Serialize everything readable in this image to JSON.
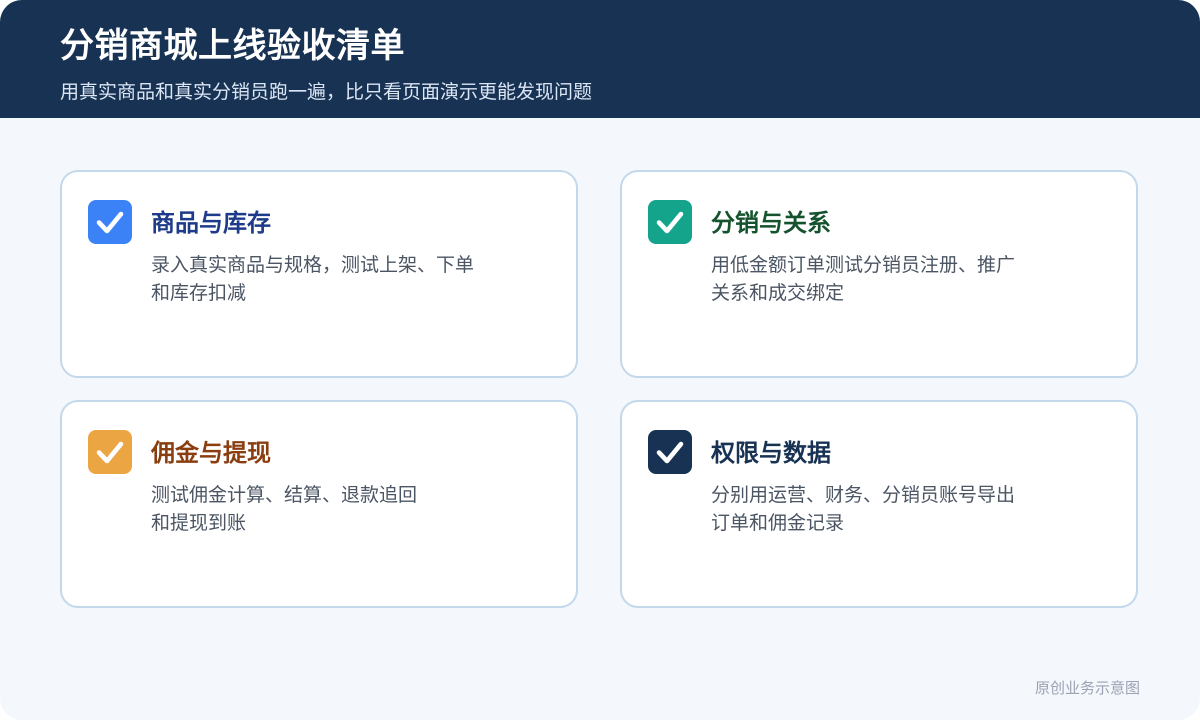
{
  "header": {
    "title": "分销商城上线验收清单",
    "subtitle": "用真实商品和真实分销员跑一遍，比只看页面演示更能发现问题",
    "background": "#183253"
  },
  "cards": [
    {
      "title": "商品与库存",
      "desc_lines": [
        "录入真实商品与规格，测试上架、下单",
        "和库存扣减"
      ],
      "check_color": "#3b82f6",
      "title_color": "#1e3a8a",
      "icon": "checkbox-checked-icon"
    },
    {
      "title": "分销与关系",
      "desc_lines": [
        "用低金额订单测试分销员注册、推广",
        "关系和成交绑定"
      ],
      "check_color": "#14a38b",
      "title_color": "#14532d",
      "icon": "checkbox-checked-icon"
    },
    {
      "title": "佣金与提现",
      "desc_lines": [
        "测试佣金计算、结算、退款追回",
        "和提现到账"
      ],
      "check_color": "#eba542",
      "title_color": "#8a3e10",
      "icon": "checkbox-checked-icon"
    },
    {
      "title": "权限与数据",
      "desc_lines": [
        "分别用运营、财务、分销员账号导出",
        "订单和佣金记录"
      ],
      "check_color": "#183253",
      "title_color": "#183253",
      "icon": "checkbox-checked-icon"
    }
  ],
  "footnote": "原创业务示意图"
}
